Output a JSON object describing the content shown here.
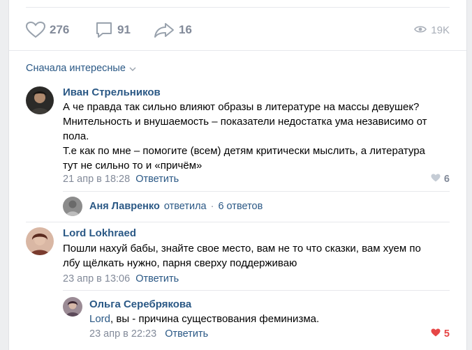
{
  "stats": {
    "likes": "276",
    "comments": "91",
    "shares": "16",
    "views": "19K"
  },
  "sort_label": "Сначала интересные",
  "comments": [
    {
      "author": "Иван Стрельников",
      "lines": [
        "А че правда так сильно влияют образы в литературе на массы девушек?",
        "Мнительность и внушаемость – показатели недостатка ума независимо от",
        "пола.",
        "Т.е как по мне – помогите (всем) детям критически мыслить, а литература",
        "тут не сильно то и «причём»"
      ],
      "date": "21 апр в 18:28",
      "reply_label": "Ответить",
      "likes": "6",
      "replies_preview": {
        "name": "Аня Лавренко",
        "verb": "ответила",
        "count": "6 ответов"
      }
    },
    {
      "author": "Lord Lokhraed",
      "lines": [
        "Пошли нахуй бабы, знайте свое место, вам не то что сказки, вам хуем по",
        "лбу щёлкать нужно, парня сверху поддерживаю"
      ],
      "date": "23 апр в 13:06",
      "reply_label": "Ответить"
    },
    {
      "author": "Ольга Серебрякова",
      "mention": "Lord",
      "text_rest": ", вы - причина существования феминизма.",
      "date": "23 апр в 22:23",
      "reply_label": "Ответить",
      "likes": "5"
    }
  ],
  "colors": {
    "link": "#2a5885",
    "meta": "#828a99",
    "like_active": "#e64646",
    "background": "#edeef0"
  }
}
